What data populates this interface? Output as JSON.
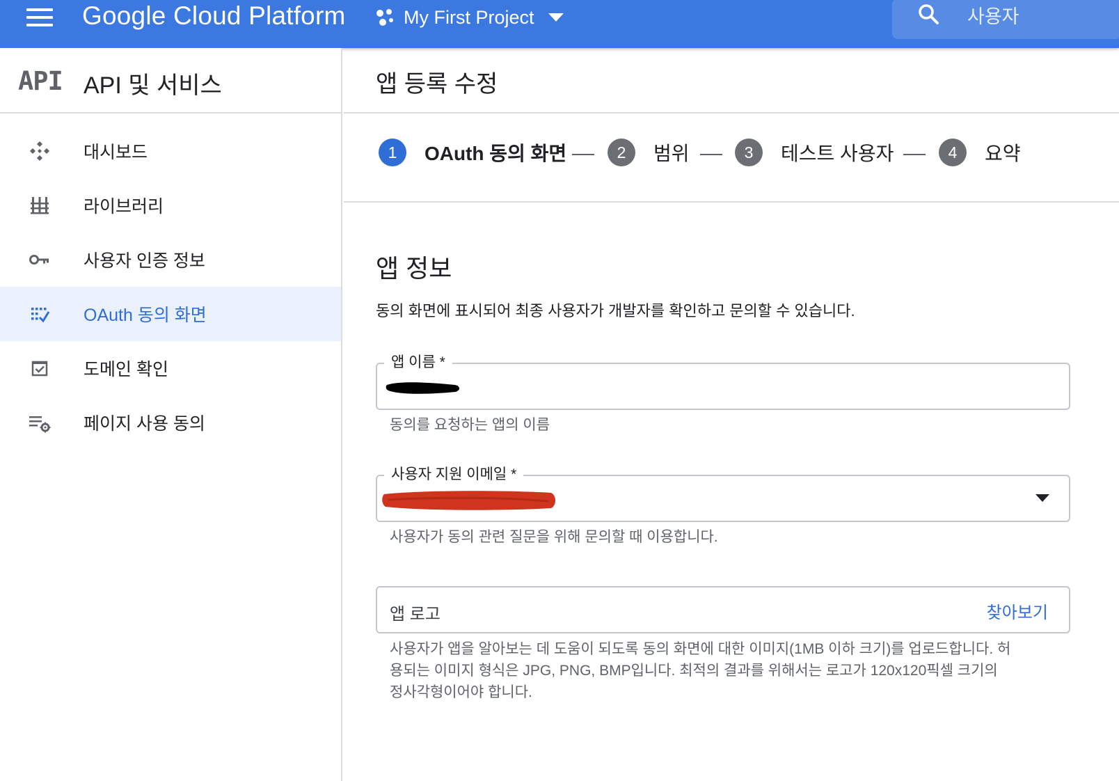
{
  "topbar": {
    "brand": "Google Cloud Platform",
    "project_name": "My First Project",
    "search_text": "사용자"
  },
  "sidebar": {
    "logo_text": "API",
    "title": "API 및 서비스",
    "items": [
      {
        "label": "대시보드",
        "icon": "dashboard-icon"
      },
      {
        "label": "라이브러리",
        "icon": "library-icon"
      },
      {
        "label": "사용자 인증 정보",
        "icon": "key-icon"
      },
      {
        "label": "OAuth 동의 화면",
        "icon": "consent-icon",
        "active": true
      },
      {
        "label": "도메인 확인",
        "icon": "checkbox-icon"
      },
      {
        "label": "페이지 사용 동의",
        "icon": "settings-list-icon"
      }
    ]
  },
  "main": {
    "page_title": "앱 등록 수정",
    "steps": [
      {
        "num": "1",
        "label": "OAuth 동의 화면"
      },
      {
        "num": "2",
        "label": "범위"
      },
      {
        "num": "3",
        "label": "테스트 사용자"
      },
      {
        "num": "4",
        "label": "요약"
      }
    ],
    "section_title": "앱 정보",
    "section_desc": "동의 화면에 표시되어 최종 사용자가 개발자를 확인하고 문의할 수 있습니다.",
    "app_name": {
      "label": "앱 이름 *",
      "helper": "동의를 요청하는 앱의 이름"
    },
    "support_email": {
      "label": "사용자 지원 이메일 *",
      "helper": "사용자가 동의 관련 질문을 위해 문의할 때 이용합니다."
    },
    "app_logo": {
      "placeholder": "앱 로고",
      "browse": "찾아보기",
      "helper_lines": [
        "사용자가 앱을 알아보는 데 도움이 되도록 동의 화면에 대한 이미지(1MB 이하 크기)를 업로드합니다. 허",
        "용되는 이미지 형식은 JPG, PNG, BMP입니다. 최적의 결과를 위해서는 로고가 120x120픽셀 크기의",
        "정사각형이어야 합니다."
      ]
    }
  },
  "colors": {
    "topbar": "#3b78e0",
    "accent": "#2f6ed6",
    "active_bg": "#eaf1fc",
    "redaction_red": "#d0341c",
    "redaction_black": "#000000"
  }
}
